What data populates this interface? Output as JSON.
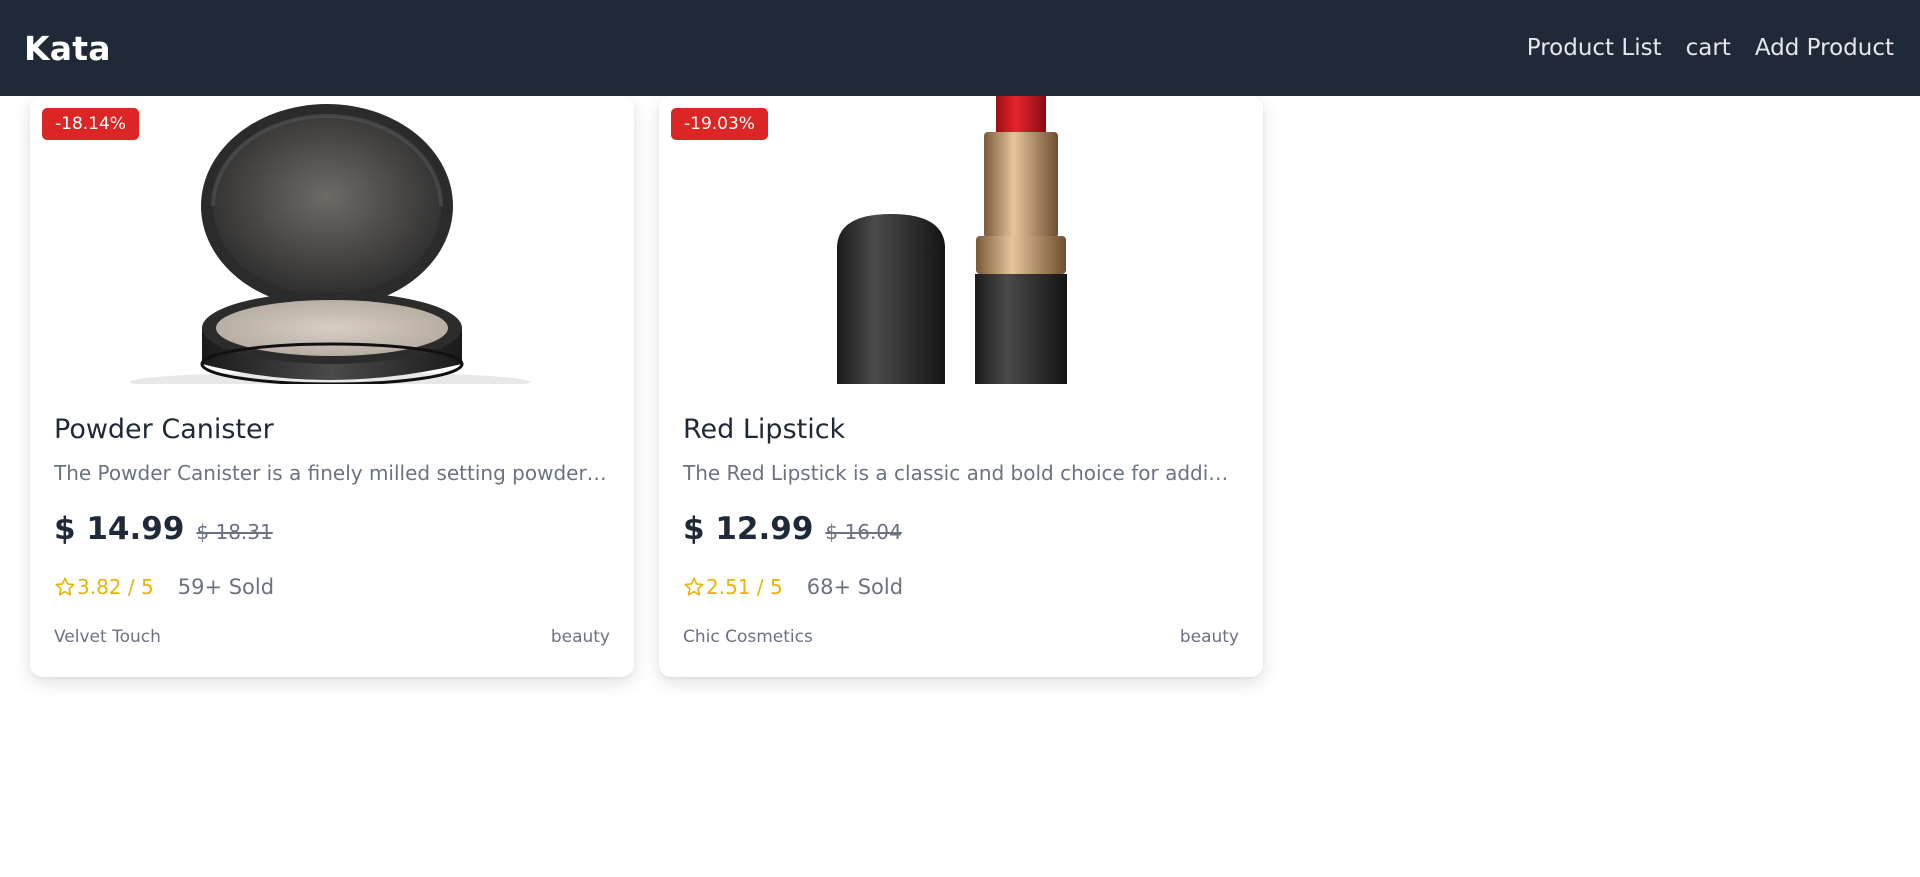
{
  "navbar": {
    "brand": "Kata",
    "links": [
      "Product List",
      "cart",
      "Add Product"
    ]
  },
  "colors": {
    "navbar_bg": "#1f2937",
    "badge_red": "#dc2626",
    "star_yellow": "#eab308"
  },
  "products": [
    {
      "discount": "-18.14%",
      "image_icon": "powder-compact-image",
      "title": "Powder Canister",
      "description": "The Powder Canister is a finely milled setting powder desi...",
      "price": "$ 14.99",
      "old_price": "$ 18.31",
      "rating": "3.82 / 5",
      "sold": "59+ Sold",
      "brand": "Velvet Touch",
      "category": "beauty"
    },
    {
      "discount": "-19.03%",
      "image_icon": "lipstick-image",
      "title": "Red Lipstick",
      "description": "The Red Lipstick is a classic and bold choice for adding a p...",
      "price": "$ 12.99",
      "old_price": "$ 16.04",
      "rating": "2.51 / 5",
      "sold": "68+ Sold",
      "brand": "Chic Cosmetics",
      "category": "beauty"
    }
  ]
}
